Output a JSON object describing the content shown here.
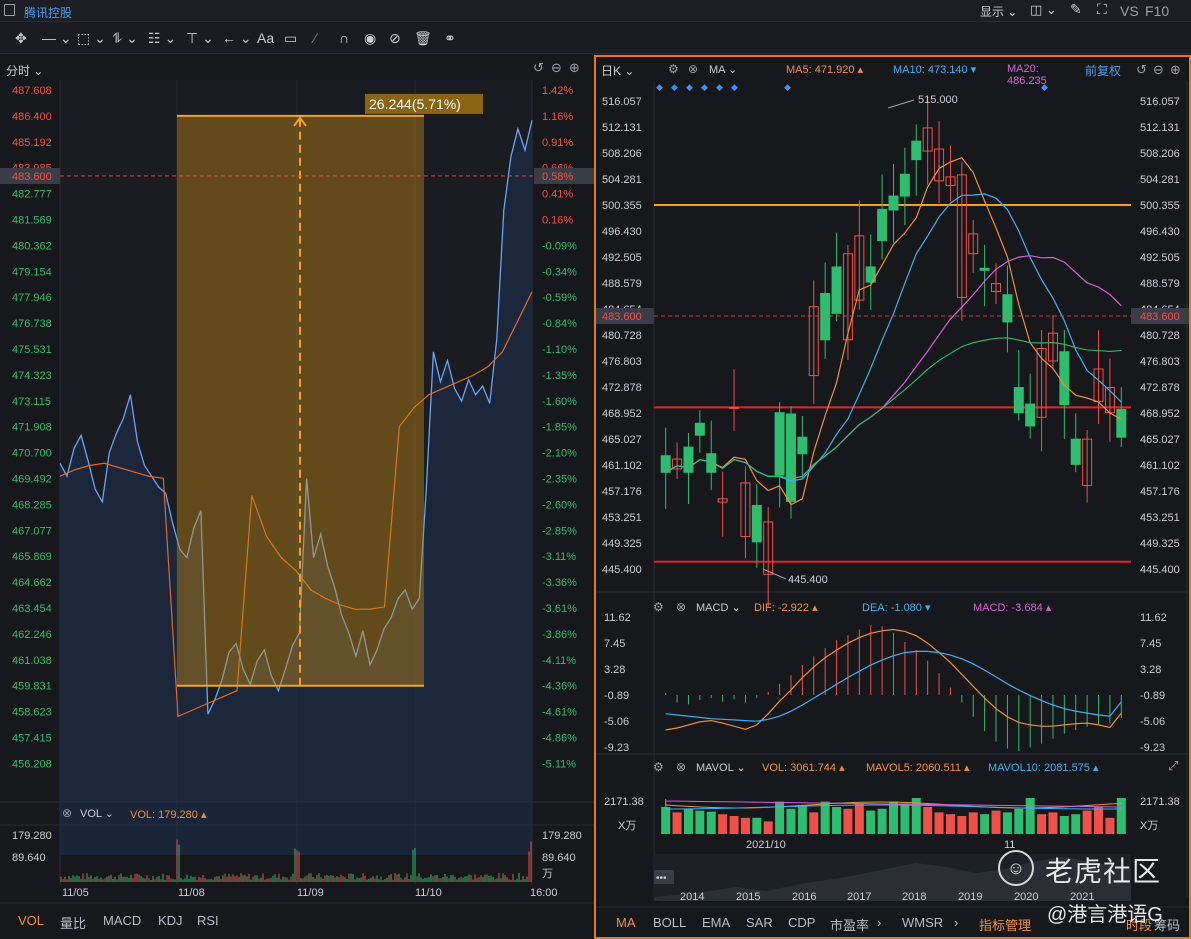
{
  "header": {
    "stock_name": "腾讯控股",
    "display_label": "显示",
    "vs_label": "VS",
    "f10_label": "F10"
  },
  "toolbar": {
    "icons": [
      "move-icon",
      "line-icon",
      "rect-icon",
      "wave-icon",
      "fib-icon",
      "text-vertical-icon",
      "arrow-icon",
      "text-icon",
      "comment-icon",
      "ruler-icon",
      "magnet-icon",
      "eye-icon",
      "hide-icon",
      "trash-icon",
      "link-icon"
    ],
    "text_tool_label": "Aa"
  },
  "intraday": {
    "period_label": "分时",
    "price_ticks": [
      "487.608",
      "486.400",
      "485.192",
      "483.985",
      "482.777",
      "481.569",
      "480.362",
      "479.154",
      "477.946",
      "476.738",
      "475.531",
      "474.323",
      "473.115",
      "471.908",
      "470.700",
      "469.492",
      "468.285",
      "467.077",
      "465.869",
      "464.662",
      "463.454",
      "462.246",
      "461.038",
      "459.831",
      "458.623",
      "457.415",
      "456.208"
    ],
    "pct_ticks": [
      "1.42%",
      "1.16%",
      "0.91%",
      "0.66%",
      "0.41%",
      "0.16%",
      "-0.09%",
      "-0.34%",
      "-0.59%",
      "-0.84%",
      "-1.10%",
      "-1.35%",
      "-1.60%",
      "-1.85%",
      "-2.10%",
      "-2.35%",
      "-2.60%",
      "-2.85%",
      "-3.11%",
      "-3.36%",
      "-3.61%",
      "-3.86%",
      "-4.11%",
      "-4.36%",
      "-4.61%",
      "-4.86%",
      "-5.11%"
    ],
    "current_price": "483.600",
    "current_pct": "0.58%",
    "measure_label": "26.244(5.71%)",
    "vol_label": "VOL",
    "vol_value": "VOL: 179.280",
    "vol_ticks": [
      "179.280",
      "89.640"
    ],
    "vol_unit": "万",
    "dates": [
      "11/05",
      "11/08",
      "11/09",
      "11/10",
      "16:00"
    ],
    "bottom_tabs": [
      "VOL",
      "量比",
      "MACD",
      "KDJ",
      "RSI"
    ]
  },
  "daily": {
    "period_label": "日K",
    "ma_label": "MA",
    "ma5": "MA5: 471.920",
    "ma10": "MA10: 473.140",
    "ma20": "MA20: 486.235",
    "adjust_label": "前复权",
    "price_ticks": [
      "516.057",
      "512.131",
      "508.206",
      "504.281",
      "500.355",
      "496.430",
      "492.505",
      "488.579",
      "484.654",
      "480.728",
      "476.803",
      "472.878",
      "468.952",
      "465.027",
      "461.102",
      "457.176",
      "453.251",
      "449.325",
      "445.400"
    ],
    "current_price": "483.600",
    "high_label": "515.000",
    "low_label": "445.400",
    "macd_label": "MACD",
    "dif": "DIF: -2.922",
    "dea": "DEA: -1.080",
    "macd_value": "MACD: -3.684",
    "macd_ticks": [
      "11.62",
      "7.45",
      "3.28",
      "-0.89",
      "-5.06",
      "-9.23"
    ],
    "mavol_label": "MAVOL",
    "vol_value": "VOL: 3061.744",
    "mavol5": "MAVOL5: 2060.511",
    "mavol10": "MAVOL10: 2081.575",
    "vol_ticks": [
      "2171.38",
      "X万"
    ],
    "date_labels": [
      "2021/10",
      "11"
    ],
    "year_labels": [
      "2014",
      "2015",
      "2016",
      "2017",
      "2018",
      "2019",
      "2020",
      "2021"
    ],
    "bottom_tabs": [
      "MA",
      "BOLL",
      "EMA",
      "SAR",
      "CDP",
      "市盈率",
      "WMSR",
      "指标管理",
      "时段"
    ],
    "bottom_tabs_partial": "筹码"
  },
  "watermark": {
    "brand": "老虎社区",
    "handle": "@港言港语G"
  },
  "colors": {
    "up": "#f0504a",
    "down": "#2ebd6f",
    "accent": "#e07a23",
    "ma5": "#ef8f39",
    "ma10": "#3db1f0",
    "ma20": "#d35fd8",
    "ma60": "#2ebd6f",
    "intraday_line": "#6aa3ef",
    "avg_line": "#e06a2a"
  },
  "chart_data": [
    {
      "type": "line",
      "title": "",
      "series": [
        {
          "name": "price",
          "values": [
            470.2,
            469.6,
            470.9,
            471.5,
            470.3,
            469.0,
            468.4,
            470.7,
            471.6,
            472.3,
            473.4,
            471.2,
            470.1,
            469.6,
            469.1,
            468.8,
            467.4,
            466.2,
            465.8,
            467.2,
            468.0,
            458.5,
            459.2,
            460.1,
            461.4,
            461.8,
            460.6,
            459.9,
            461.0,
            461.5,
            460.3,
            459.6,
            460.6,
            461.7,
            462.3,
            469.5,
            465.8,
            466.9,
            465.4,
            464.4,
            463.1,
            462.3,
            461.2,
            462.4,
            460.8,
            461.5,
            462.5,
            463.0,
            463.9,
            464.3,
            463.4,
            463.9,
            469.0,
            475.4,
            474.0,
            475.0,
            473.7,
            473.1,
            474.1,
            473.4,
            473.8,
            473.0,
            476.0,
            482.0,
            484.5,
            485.8,
            484.8,
            486.2
          ]
        },
        {
          "name": "avg",
          "values": [
            469.6,
            469.9,
            470.1,
            470.2,
            470.0,
            469.8,
            469.6,
            469.5,
            458.4,
            458.7,
            459.0,
            459.3,
            459.6,
            468.7,
            466.8,
            465.8,
            465.2,
            464.3,
            463.9,
            463.6,
            463.4,
            463.4,
            463.5,
            471.9,
            472.8,
            473.4,
            473.7,
            474.0,
            474.3,
            474.7,
            475.4,
            476.8,
            478.2
          ]
        }
      ],
      "ylim": [
        456.208,
        487.608
      ],
      "x": [
        "11/05",
        "11/08",
        "11/09",
        "11/10",
        "16:00"
      ]
    },
    {
      "type": "bar",
      "title": "",
      "series": [
        {
          "name": "O",
          "values": [
            462.5,
            460.5,
            463.8,
            467.4,
            462.8,
            455.5,
            469.8,
            450.3,
            455.0,
            444.6,
            469.0,
            468.8,
            465.3,
            474.6,
            487.0,
            491.0,
            480.0,
            486.0,
            491.0,
            499.7,
            501.7,
            505.0,
            510.0,
            508.5,
            504.0,
            503.3,
            486.4,
            493.0,
            490.8,
            487.3,
            486.8,
            472.8,
            470.3,
            468.3,
            476.8,
            478.2,
            465.0,
            458.0,
            470.7,
            469.0,
            469.5
          ]
        },
        {
          "name": "C",
          "values": [
            460.0,
            462.0,
            460.0,
            465.6,
            460.0,
            456.0,
            469.8,
            458.4,
            449.5,
            452.5,
            459.6,
            455.6,
            462.8,
            485.0,
            480.0,
            484.0,
            493.0,
            495.7,
            488.7,
            495.0,
            499.6,
            501.7,
            507.2,
            512.0,
            508.8,
            504.6,
            504.9,
            496.0,
            490.5,
            488.5,
            482.7,
            469.0,
            467.0,
            478.7,
            481.0,
            470.2,
            461.2,
            465.0,
            475.6,
            472.8,
            465.3
          ]
        }
      ],
      "ylim": [
        445.4,
        516.057
      ]
    }
  ]
}
